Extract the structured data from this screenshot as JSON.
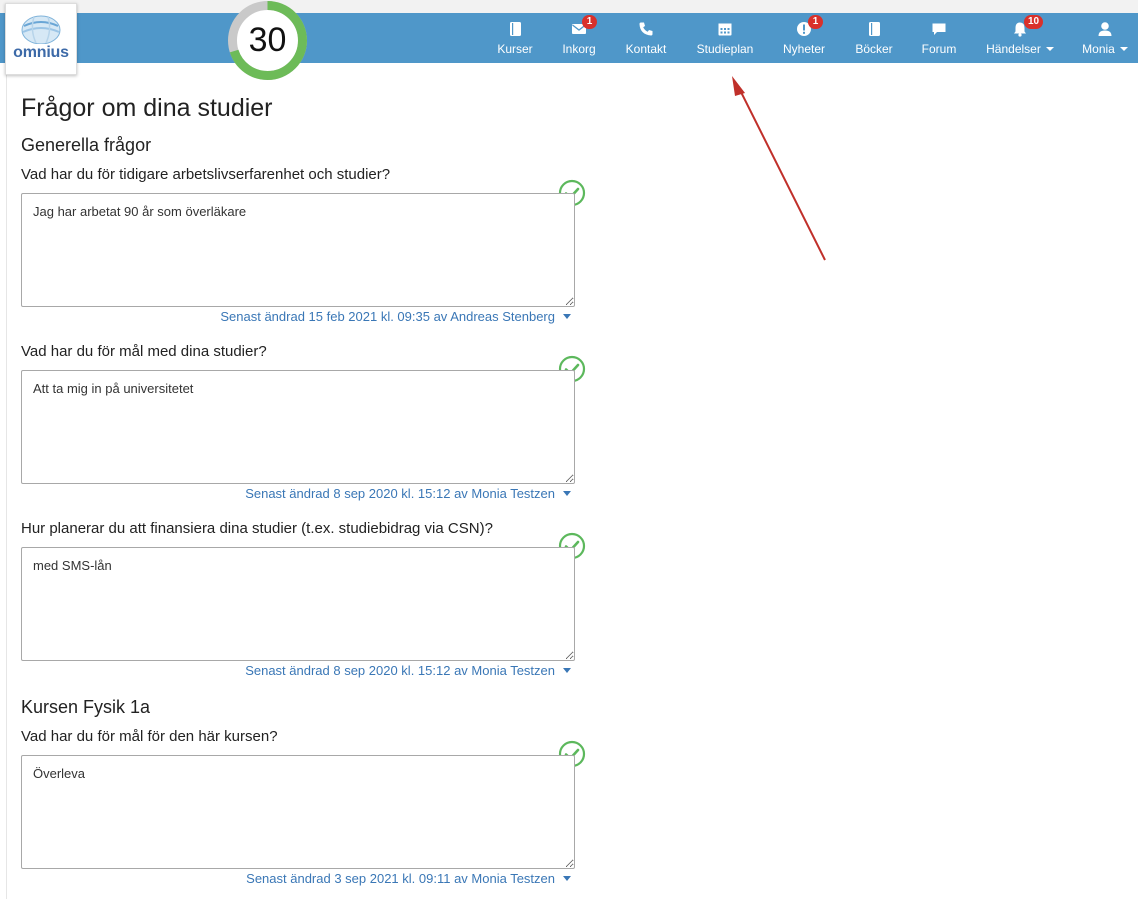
{
  "app": {
    "logo_text": "omnius",
    "progress_value": "30"
  },
  "nav": {
    "items": [
      {
        "label": "Kurser",
        "icon": "book-icon"
      },
      {
        "label": "Inkorg",
        "icon": "envelope-icon",
        "badge": "1"
      },
      {
        "label": "Kontakt",
        "icon": "phone-icon"
      },
      {
        "label": "Studieplan",
        "icon": "calendar-icon"
      },
      {
        "label": "Nyheter",
        "icon": "alert-icon",
        "badge": "1"
      },
      {
        "label": "Böcker",
        "icon": "books-icon"
      },
      {
        "label": "Forum",
        "icon": "comment-icon"
      },
      {
        "label": "Händelser",
        "icon": "bell-icon",
        "badge": "10",
        "dropdown": true
      },
      {
        "label": "Monia",
        "icon": "user-icon",
        "dropdown": true
      }
    ]
  },
  "page": {
    "title": "Frågor om dina studier",
    "sections": [
      {
        "heading": "Generella frågor",
        "questions": [
          {
            "question": "Vad har du för tidigare arbetslivserfarenhet och studier?",
            "answer": "Jag har arbetat 90 år som överläkare",
            "edited": "Senast ändrad 15 feb 2021 kl. 09:35 av Andreas Stenberg"
          },
          {
            "question": "Vad har du för mål med dina studier?",
            "answer": "Att ta mig in på universitetet",
            "edited": "Senast ändrad 8 sep 2020 kl. 15:12 av Monia Testzen"
          },
          {
            "question": "Hur planerar du att finansiera dina studier (t.ex. studiebidrag via CSN)?",
            "answer": "med SMS-lån",
            "edited": "Senast ändrad 8 sep 2020 kl. 15:12 av Monia Testzen"
          }
        ]
      },
      {
        "heading": "Kursen Fysik 1a",
        "questions": [
          {
            "question": "Vad har du för mål för den här kursen?",
            "answer": "Överleva",
            "edited": "Senast ändrad 3 sep 2021 kl. 09:11 av Monia Testzen"
          }
        ]
      }
    ]
  },
  "colors": {
    "navbar": "#4f97c9",
    "badge": "#d9312b",
    "check": "#5cb85c",
    "link": "#3a77b6",
    "annotation_arrow": "#c0302a"
  }
}
